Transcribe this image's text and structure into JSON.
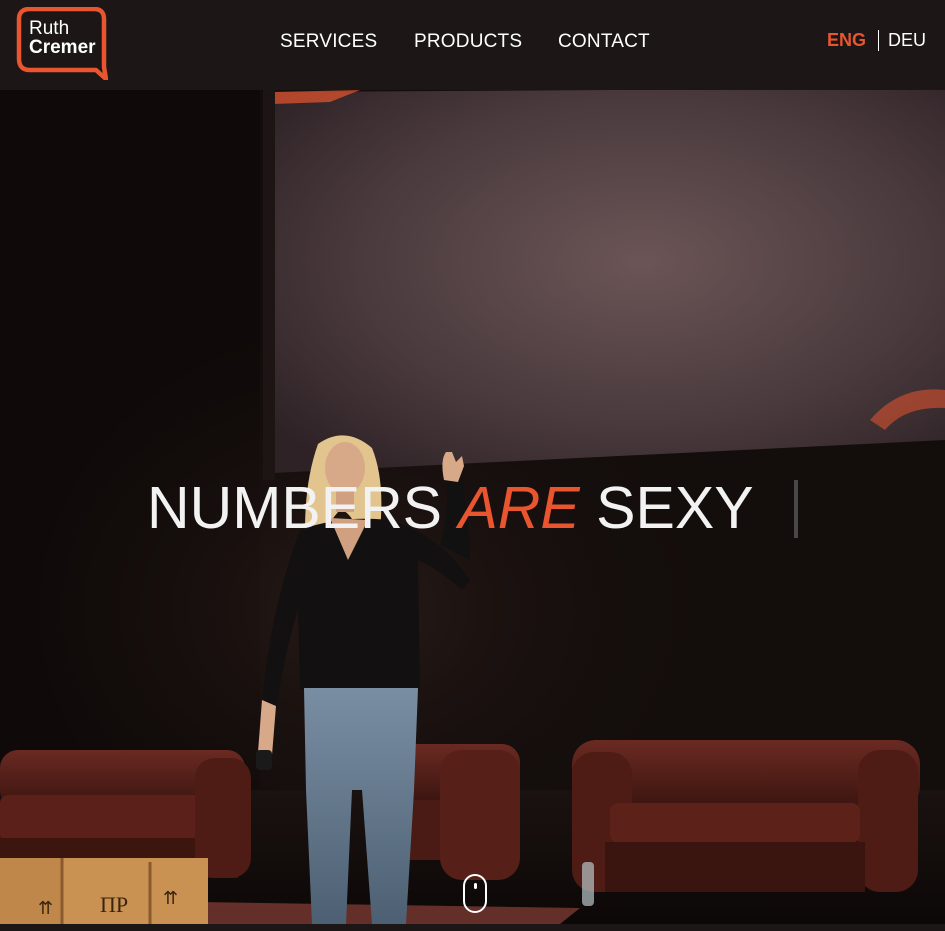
{
  "logo": {
    "line1": "Ruth",
    "line2": "Cremer"
  },
  "nav": {
    "items": [
      {
        "label": "SERVICES"
      },
      {
        "label": "PRODUCTS"
      },
      {
        "label": "CONTACT"
      }
    ]
  },
  "language": {
    "active": "ENG",
    "other": "DEU"
  },
  "hero": {
    "headline_part1": "NUMBERS",
    "headline_accent": "ARE",
    "headline_part2": "SEXY"
  },
  "colors": {
    "accent": "#e8552f",
    "header_bg": "#1c1716",
    "text": "#ffffff"
  },
  "icons": {
    "scroll": "scroll-mouse-icon"
  }
}
